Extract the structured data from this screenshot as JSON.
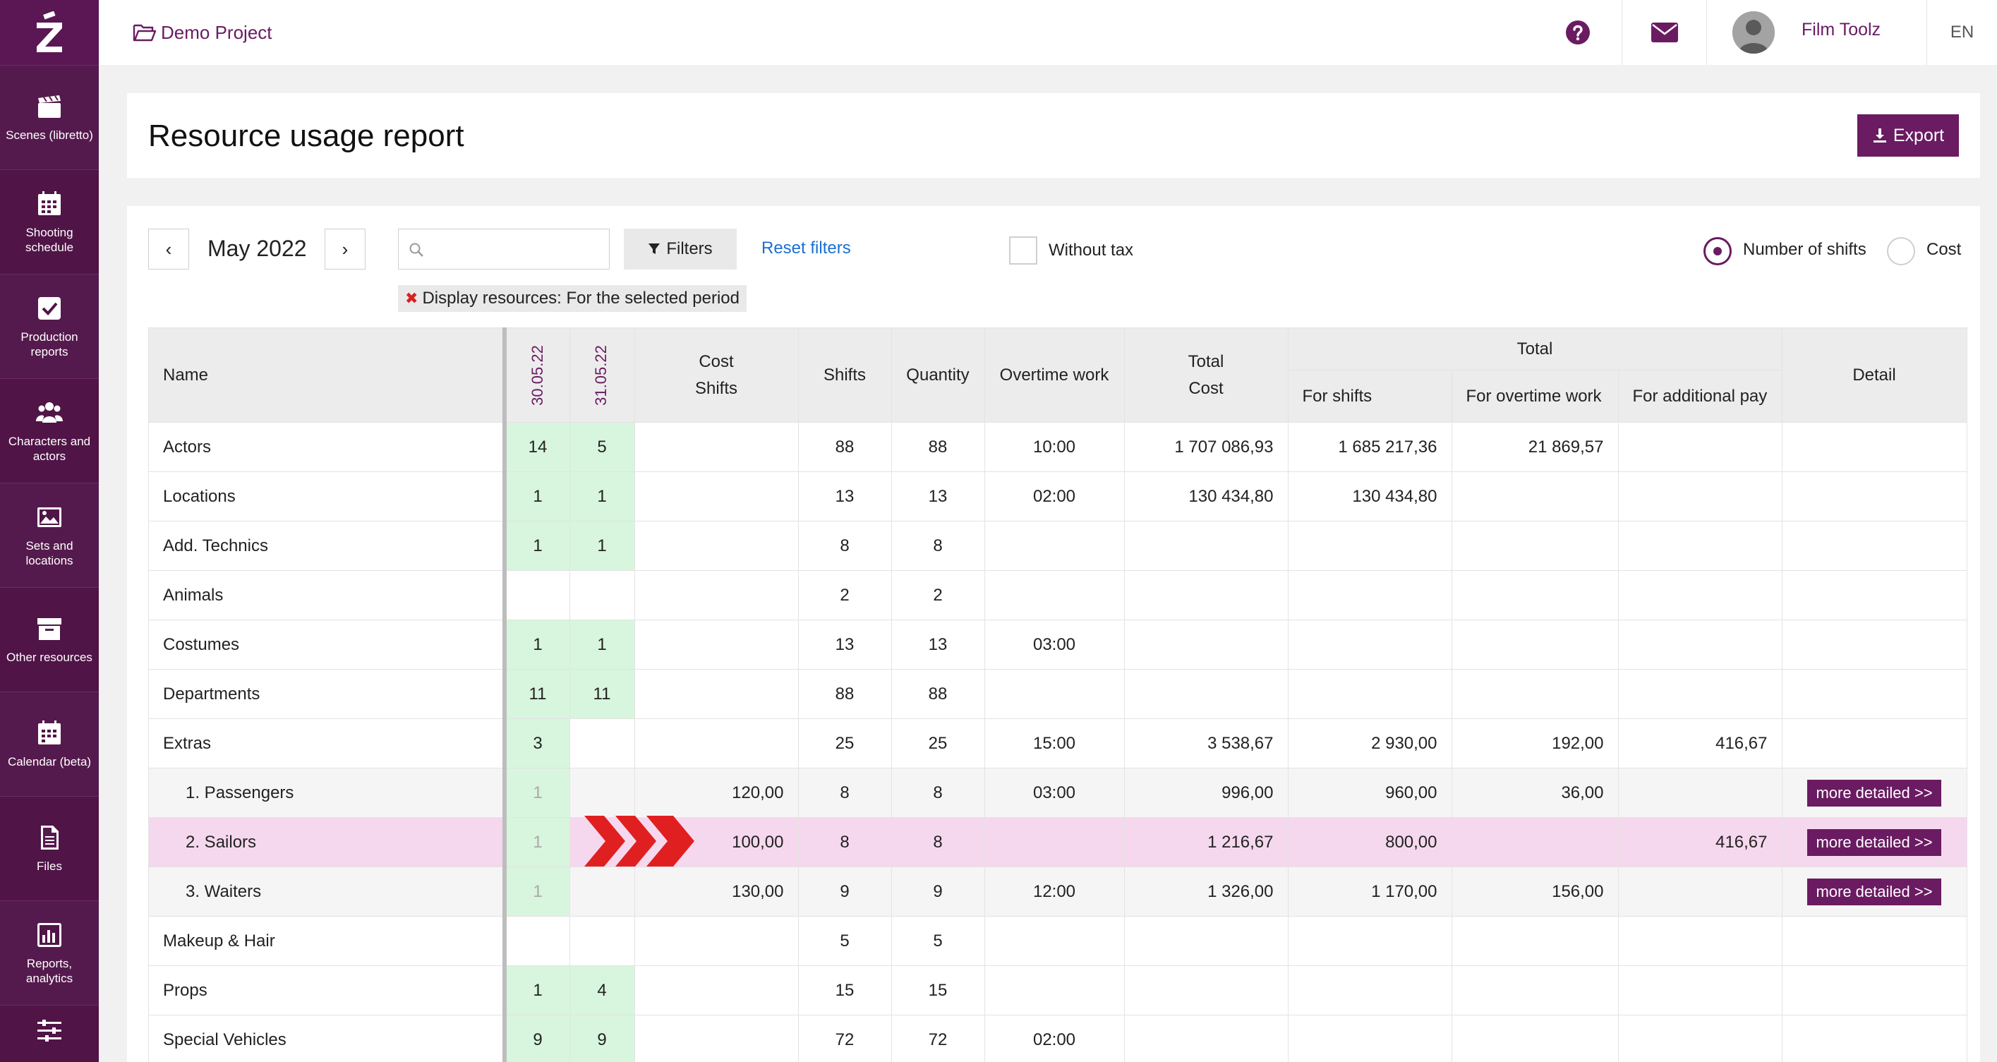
{
  "sidebar": {
    "items": [
      {
        "label": "Scenes (libretto)",
        "icon": "clapperboard-icon"
      },
      {
        "label": "Shooting schedule",
        "icon": "calendar-grid-icon"
      },
      {
        "label": "Production reports",
        "icon": "checkbox-icon"
      },
      {
        "label": "Characters and actors",
        "icon": "users-icon"
      },
      {
        "label": "Sets and locations",
        "icon": "image-icon"
      },
      {
        "label": "Other resources",
        "icon": "archive-icon"
      },
      {
        "label": "Calendar (beta)",
        "icon": "calendar-icon"
      },
      {
        "label": "Files",
        "icon": "file-icon"
      },
      {
        "label": "Reports, analytics",
        "icon": "chart-icon"
      },
      {
        "label": "",
        "icon": "sliders-icon"
      }
    ]
  },
  "topbar": {
    "project": "Demo Project",
    "user_name": "Film Toolz",
    "language": "EN"
  },
  "header": {
    "title": "Resource usage report",
    "export_label": "Export"
  },
  "toolbar": {
    "prev": "‹",
    "next": "›",
    "month": "May 2022",
    "search_placeholder": "",
    "filters_label": "Filters",
    "reset_label": "Reset filters",
    "without_tax_label": "Without tax",
    "without_tax_checked": false,
    "radio_shifts_label": "Number of shifts",
    "radio_cost_label": "Cost",
    "selected_mode": "Number of shifts",
    "filter_tag_key": "Display resources:",
    "filter_tag_value": "For the selected period"
  },
  "table": {
    "headers": {
      "name": "Name",
      "date1": "30.05.22",
      "date2": "31.05.22",
      "cost_shifts_1": "Cost",
      "cost_shifts_2": "Shifts",
      "shifts": "Shifts",
      "quantity": "Quantity",
      "overtime": "Overtime work",
      "total_cost_1": "Total",
      "total_cost_2": "Cost",
      "total_group": "Total",
      "for_shifts": "For shifts",
      "for_overtime": "For overtime work",
      "for_additional": "For additional pay",
      "detail": "Detail"
    },
    "detail_button": "more detailed >>",
    "rows": [
      {
        "name": "Actors",
        "d1": "14",
        "d2": "5",
        "cost_shifts": "",
        "shifts": "88",
        "quantity": "88",
        "overtime": "10:00",
        "total_cost": "1 707 086,93",
        "for_shifts": "1 685 217,36",
        "for_overtime": "21 869,57",
        "for_additional": ""
      },
      {
        "name": "Locations",
        "d1": "1",
        "d2": "1",
        "cost_shifts": "",
        "shifts": "13",
        "quantity": "13",
        "overtime": "02:00",
        "total_cost": "130 434,80",
        "for_shifts": "130 434,80",
        "for_overtime": "",
        "for_additional": ""
      },
      {
        "name": "Add. Technics",
        "d1": "1",
        "d2": "1",
        "cost_shifts": "",
        "shifts": "8",
        "quantity": "8",
        "overtime": "",
        "total_cost": "",
        "for_shifts": "",
        "for_overtime": "",
        "for_additional": ""
      },
      {
        "name": "Animals",
        "d1": "",
        "d2": "",
        "cost_shifts": "",
        "shifts": "2",
        "quantity": "2",
        "overtime": "",
        "total_cost": "",
        "for_shifts": "",
        "for_overtime": "",
        "for_additional": ""
      },
      {
        "name": "Costumes",
        "d1": "1",
        "d2": "1",
        "cost_shifts": "",
        "shifts": "13",
        "quantity": "13",
        "overtime": "03:00",
        "total_cost": "",
        "for_shifts": "",
        "for_overtime": "",
        "for_additional": ""
      },
      {
        "name": "Departments",
        "d1": "11",
        "d2": "11",
        "cost_shifts": "",
        "shifts": "88",
        "quantity": "88",
        "overtime": "",
        "total_cost": "",
        "for_shifts": "",
        "for_overtime": "",
        "for_additional": ""
      },
      {
        "name": "Extras",
        "d1": "3",
        "d2": "",
        "cost_shifts": "",
        "shifts": "25",
        "quantity": "25",
        "overtime": "15:00",
        "total_cost": "3 538,67",
        "for_shifts": "2 930,00",
        "for_overtime": "192,00",
        "for_additional": "416,67"
      },
      {
        "name": "1. Passengers",
        "d1": "1",
        "d2": "",
        "cost_shifts": "120,00",
        "shifts": "8",
        "quantity": "8",
        "overtime": "03:00",
        "total_cost": "996,00",
        "for_shifts": "960,00",
        "for_overtime": "36,00",
        "for_additional": ""
      },
      {
        "name": "2. Sailors",
        "d1": "1",
        "d2": "",
        "cost_shifts": "100,00",
        "shifts": "8",
        "quantity": "8",
        "overtime": "",
        "total_cost": "1 216,67",
        "for_shifts": "800,00",
        "for_overtime": "",
        "for_additional": "416,67"
      },
      {
        "name": "3. Waiters",
        "d1": "1",
        "d2": "",
        "cost_shifts": "130,00",
        "shifts": "9",
        "quantity": "9",
        "overtime": "12:00",
        "total_cost": "1 326,00",
        "for_shifts": "1 170,00",
        "for_overtime": "156,00",
        "for_additional": ""
      },
      {
        "name": "Makeup & Hair",
        "d1": "",
        "d2": "",
        "cost_shifts": "",
        "shifts": "5",
        "quantity": "5",
        "overtime": "",
        "total_cost": "",
        "for_shifts": "",
        "for_overtime": "",
        "for_additional": ""
      },
      {
        "name": "Props",
        "d1": "1",
        "d2": "4",
        "cost_shifts": "",
        "shifts": "15",
        "quantity": "15",
        "overtime": "",
        "total_cost": "",
        "for_shifts": "",
        "for_overtime": "",
        "for_additional": ""
      },
      {
        "name": "Special Vehicles",
        "d1": "9",
        "d2": "9",
        "cost_shifts": "",
        "shifts": "72",
        "quantity": "72",
        "overtime": "02:00",
        "total_cost": "",
        "for_shifts": "",
        "for_overtime": "",
        "for_additional": ""
      }
    ]
  },
  "colors": {
    "brand": "#6a1b62",
    "sidebar": "#4b0f45",
    "green_cell": "#d8f5dd",
    "highlight_row": "#f6d8ee",
    "arrow": "#e02020",
    "link": "#1a6fd3"
  }
}
